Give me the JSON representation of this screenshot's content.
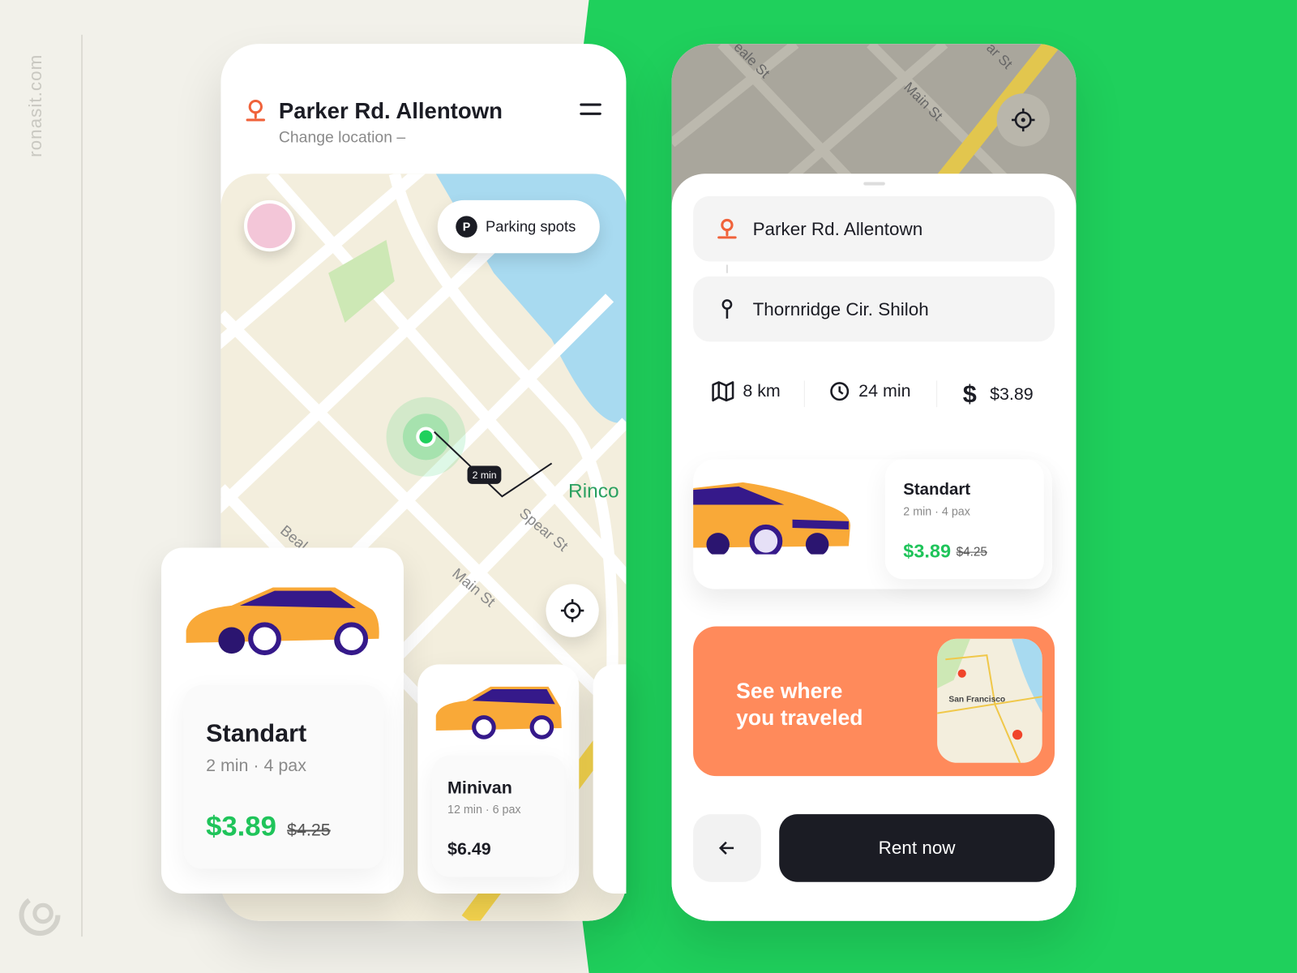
{
  "watermark": "ronasit.com",
  "left_phone": {
    "header": {
      "title": "Parker Rd. Allentown",
      "subtitle": "Change location –"
    },
    "map": {
      "parking_label": "Parking spots",
      "parking_icon": "P",
      "eta_badge": "2 min",
      "street_labels": [
        "Beal",
        "Main St",
        "Spear St",
        "Rinco"
      ]
    },
    "cars": [
      {
        "name": "Standart",
        "meta": "2 min · 4 pax",
        "price": "$3.89",
        "old_price": "$4.25"
      },
      {
        "name": "Minivan",
        "meta": "12 min · 6 pax",
        "price": "$6.49"
      }
    ]
  },
  "right_phone": {
    "map": {
      "street_labels": [
        "eale St",
        "Main St",
        "ar St"
      ]
    },
    "from": "Parker Rd. Allentown",
    "to": "Thornridge Cir. Shiloh",
    "stats": {
      "distance": "8 km",
      "duration": "24 min",
      "price": "$3.89"
    },
    "selected": {
      "name": "Standart",
      "meta": "2 min · 4 pax",
      "price": "$3.89",
      "old_price": "$4.25"
    },
    "banner": {
      "line1": "See where",
      "line2": "you traveled",
      "map_label": "San Francisco",
      "colors": {
        "bg": "#ff8a5b"
      }
    },
    "rent_label": "Rent now"
  },
  "colors": {
    "accent": "#1fd05c",
    "price": "#1fc45a",
    "pin": "#f0623a",
    "dark": "#1b1c24"
  }
}
